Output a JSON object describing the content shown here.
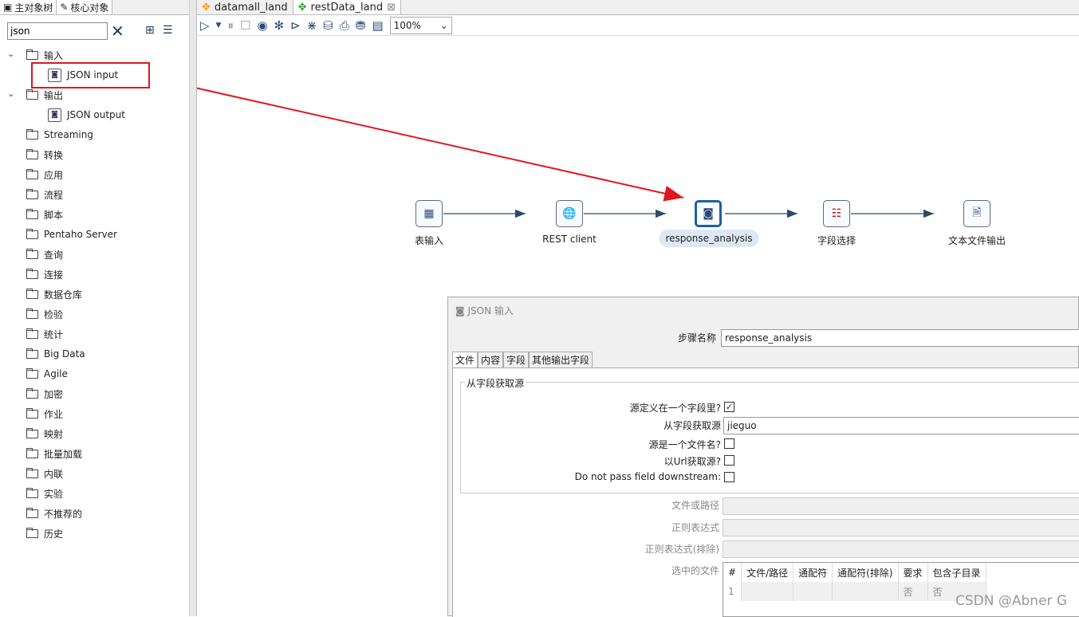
{
  "left_panel": {
    "tabs": [
      "主对象树",
      "核心对象"
    ],
    "search_value": "json",
    "tree": [
      {
        "label": "输入",
        "expanded": true,
        "children": [
          "JSON input"
        ]
      },
      {
        "label": "输出",
        "expanded": true,
        "children": [
          "JSON output"
        ]
      },
      {
        "label": "Streaming"
      },
      {
        "label": "转换"
      },
      {
        "label": "应用"
      },
      {
        "label": "流程"
      },
      {
        "label": "脚本"
      },
      {
        "label": "Pentaho Server"
      },
      {
        "label": "查询"
      },
      {
        "label": "连接"
      },
      {
        "label": "数据仓库"
      },
      {
        "label": "检验"
      },
      {
        "label": "统计"
      },
      {
        "label": "Big Data"
      },
      {
        "label": "Agile"
      },
      {
        "label": "加密"
      },
      {
        "label": "作业"
      },
      {
        "label": "映射"
      },
      {
        "label": "批量加载"
      },
      {
        "label": "内联"
      },
      {
        "label": "实验"
      },
      {
        "label": "不推荐的"
      },
      {
        "label": "历史"
      }
    ]
  },
  "editor": {
    "tabs": [
      {
        "label": "datamall_land"
      },
      {
        "label": "restData_land",
        "active": true
      }
    ],
    "zoom": "100%",
    "steps": [
      "表输入",
      "REST client",
      "response_analysis",
      "字段选择",
      "文本文件输出"
    ],
    "selected_step": "response_analysis",
    "annotation_color": "#e0161d"
  },
  "dialog": {
    "title": "JSON 输入",
    "step_name_label": "步骤名称",
    "step_name": "response_analysis",
    "tabs": [
      "文件",
      "内容",
      "字段",
      "其他输出字段"
    ],
    "group_title": "从字段获取源",
    "src_in_field_label": "源定义在一个字段里?",
    "src_in_field": true,
    "src_field_label": "从字段获取源",
    "src_field": "jieguo",
    "src_is_file_label": "源是一个文件名?",
    "src_is_file": false,
    "src_url_label": "以Url获取源?",
    "src_url": false,
    "no_pass_label": "Do not pass field downstream:",
    "no_pass": false,
    "file_path_label": "文件或路径",
    "regex_label": "正则表达式",
    "regex_exclude_label": "正则表达式(排除)",
    "selected_files_label": "选中的文件",
    "table_headers": [
      "#",
      "文件/路径",
      "通配符",
      "通配符(排除)",
      "要求",
      "包含子目录"
    ],
    "table_rows": [
      [
        "1",
        "",
        "",
        "",
        "否",
        "否"
      ]
    ]
  },
  "watermark": "CSDN @Abner G"
}
